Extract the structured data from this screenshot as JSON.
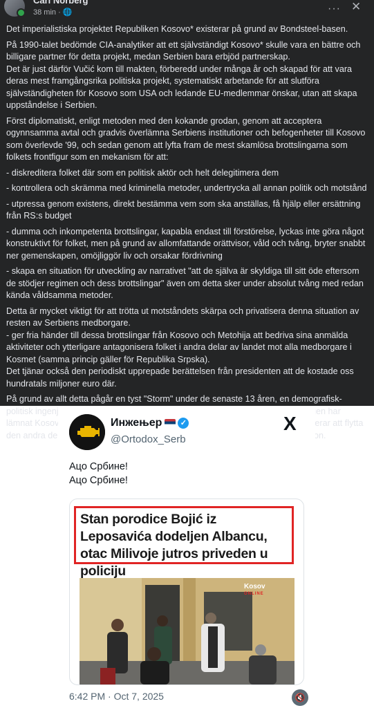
{
  "fb_post": {
    "author": "Carl Norberg",
    "time": "38 min",
    "more_label": "···",
    "close_label": "✕",
    "paragraphs": [
      "Det imperialistiska projektet Republiken Kosovo* existerar på grund av Bondsteel-basen.",
      "På 1990-talet bedömde CIA-analytiker att ett självständigt Kosovo* skulle vara en bättre och billigare partner för detta projekt, medan Serbien bara erbjöd partnerskap.",
      "Det är just därför Vučić kom till makten, förberedd under många år och skapad för att vara deras mest framgångsrika politiska projekt, systematiskt arbetande för att slutföra självständigheten för Kosovo som USA och ledande EU-medlemmar önskar, utan att skapa uppståndelse i Serbien.",
      "Först diplomatiskt, enligt metoden med den kokande grodan, genom att acceptera ogynnsamma avtal och gradvis överlämna Serbiens institutioner och befogenheter till Kosovo som överlevde '99, och sedan genom att lyfta fram de mest skamlösa brottslingarna som folkets frontfigur som en mekanism för att:",
      "- diskreditera folket där som en politisk aktör och helt delegitimera dem",
      "- kontrollera och skrämma med kriminella metoder, undertrycka all annan politik och motstånd",
      "- utpressa genom existens, direkt bestämma vem som ska anställas, få hjälp eller ersättning från RS:s budget",
      "- dumma och inkompetenta brottslingar, kapabla endast till förstörelse, lyckas inte göra något konstruktivt för folket, men på grund av allomfattande orättvisor, våld och tvång, bryter snabbt ner gemenskapen, omöjliggör liv och orsakar fördrivning",
      "- skapa en situation för utveckling av narrativet \"att de själva är skyldiga till sitt öde eftersom de stödjer regimen och dess brottslingar\" även om detta sker under absolut tvång med redan kända våldsamma metoder.",
      "Detta är mycket viktigt för att trötta ut motståndets skärpa och privatisera denna situation av resten av Serbiens medborgare.",
      "- ger fria händer till dessa brottslingar från Kosovo och Metohija att bedriva sina anmälda aktiviteter och ytterligare antagonisera folket i andra delar av landet mot alla medborgare i Kosmet (samma princip gäller för Republika Srpska).",
      "Det tjänar också den periodiskt upprepade berättelsen från presidenten att de kostade oss hundratals miljoner euro där.",
      "På grund av allt detta pågår en tyst \"Storm\" under de senaste 13 åren, en demografisk-politisk ingenjörskonst, exodus, där en tredjedel av den icke-albanska befolkningen har lämnat Kosovo och Metohija. AV-regimen bygger byggnader i Raška där de planerar att flytta den andra delen av befolkningen. Deras (USA-EU-AV) politik för KiM är emigration."
    ]
  },
  "tweet": {
    "name": "Инжењер",
    "verified_mark": "✓",
    "handle": "@Ortodox_Serb",
    "x_logo": "X",
    "text_line1": "Ацо Србине!",
    "text_line2": "Ацо Србине!",
    "headline": "Stan porodice Bojić iz Leposavića dodeljen Albancu, otac Milivoje jutros priveden u policiju",
    "watermark_main": "Kosov",
    "watermark_sub": "ONLINE",
    "timestamp": "6:42 PM · Oct 7, 2025",
    "sound_icon": "🔇"
  }
}
